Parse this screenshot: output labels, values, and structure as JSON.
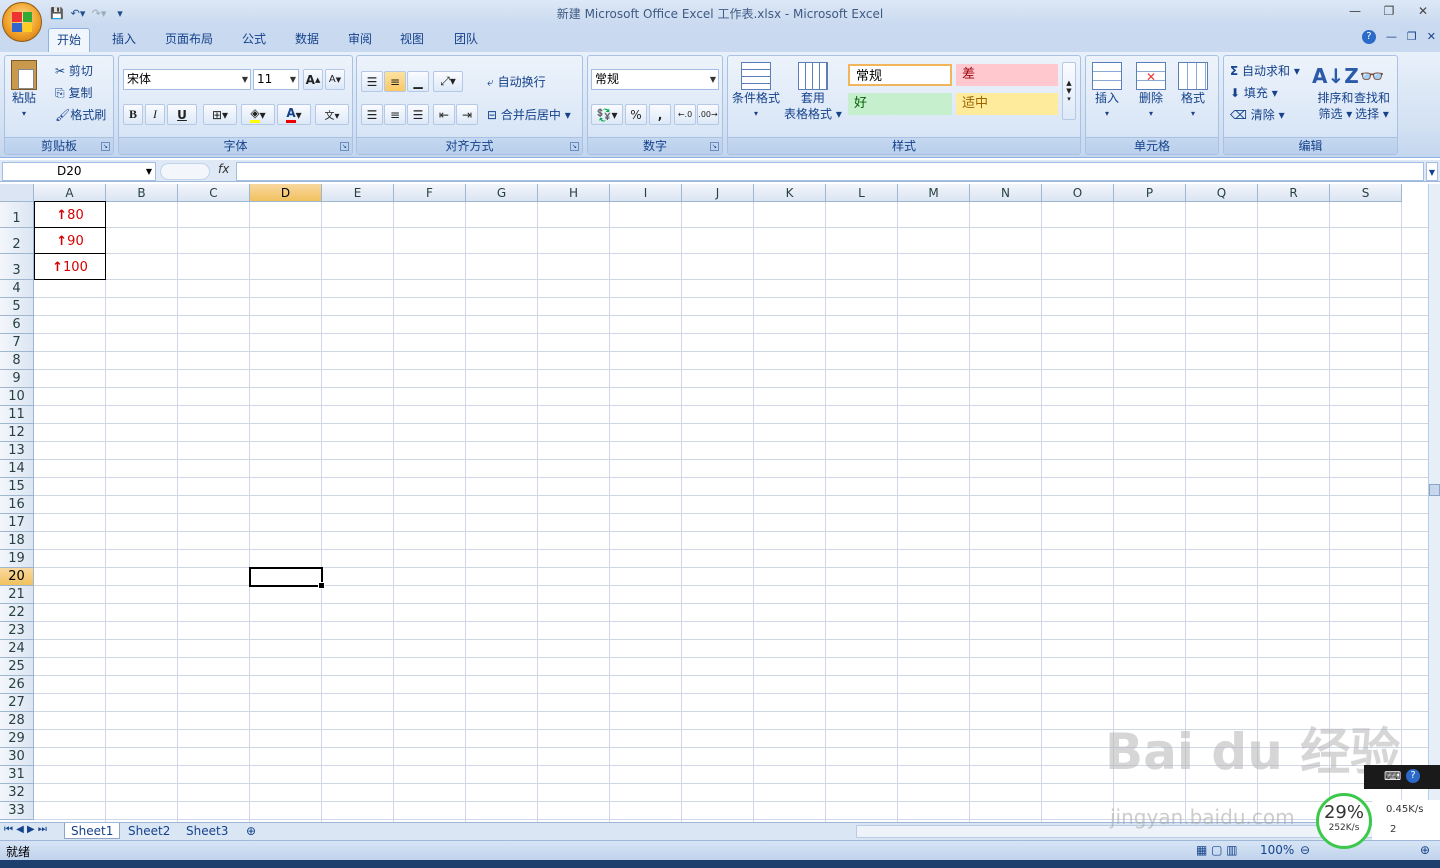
{
  "window": {
    "title": "新建 Microsoft Office Excel 工作表.xlsx - Microsoft Excel",
    "controls": [
      "—",
      "❐",
      "✕"
    ]
  },
  "tabs": [
    "开始",
    "插入",
    "页面布局",
    "公式",
    "数据",
    "审阅",
    "视图",
    "团队"
  ],
  "ribbon": {
    "clipboard": {
      "label": "剪贴板",
      "paste": "粘贴",
      "cut": "剪切",
      "copy": "复制",
      "format_painter": "格式刷"
    },
    "font": {
      "label": "字体",
      "font_name": "宋体",
      "font_size": "11",
      "bold": "B",
      "italic": "I",
      "underline": "U"
    },
    "alignment": {
      "label": "对齐方式",
      "wrap_text": "自动换行",
      "merge_center": "合并后居中"
    },
    "number": {
      "label": "数字",
      "format": "常规",
      "percent": "%",
      "comma": ","
    },
    "styles": {
      "label": "样式",
      "conditional": "条件格式",
      "table_format_1": "套用",
      "table_format_2": "表格格式",
      "normal": "常规",
      "bad": "差",
      "good": "好",
      "neutral": "适中"
    },
    "cells": {
      "label": "单元格",
      "insert": "插入",
      "delete": "删除",
      "format": "格式"
    },
    "editing": {
      "label": "编辑",
      "autosum": "自动求和",
      "fill": "填充",
      "clear": "清除",
      "sort_1": "排序和",
      "sort_2": "筛选",
      "find_1": "查找和",
      "find_2": "选择"
    }
  },
  "formula_bar": {
    "name_box": "D20",
    "fx": "fx",
    "value": ""
  },
  "columns": [
    "A",
    "B",
    "C",
    "D",
    "E",
    "F",
    "G",
    "H",
    "I",
    "J",
    "K",
    "L",
    "M",
    "N",
    "O",
    "P",
    "Q",
    "R",
    "S"
  ],
  "rows": [
    "1",
    "2",
    "3",
    "4",
    "5",
    "6",
    "7",
    "8",
    "9",
    "10",
    "11",
    "12",
    "13",
    "14",
    "15",
    "16",
    "17",
    "18",
    "19",
    "20",
    "21",
    "22",
    "23",
    "24",
    "25",
    "26",
    "27",
    "28",
    "29",
    "30",
    "31",
    "32",
    "33"
  ],
  "cells": [
    {
      "ref": "A1",
      "value": "80",
      "icon": "up-arrow"
    },
    {
      "ref": "A2",
      "value": "90",
      "icon": "up-arrow"
    },
    {
      "ref": "A3",
      "value": "100",
      "icon": "up-arrow"
    }
  ],
  "selected_cell": "D20",
  "sheet_tabs": [
    "Sheet1",
    "Sheet2",
    "Sheet3"
  ],
  "status": {
    "ready": "就绪",
    "zoom": "100%"
  },
  "overlay": {
    "watermark": "Bai du 经验",
    "watermark_url": "jingyan.baidu.com",
    "net_percent": "29%",
    "upload": "0.45K/s",
    "download": "252K/s",
    "count": "2"
  },
  "colors": {
    "accent": "#15428b",
    "selected_header": "#f9d99f",
    "value_red": "#d40000"
  }
}
